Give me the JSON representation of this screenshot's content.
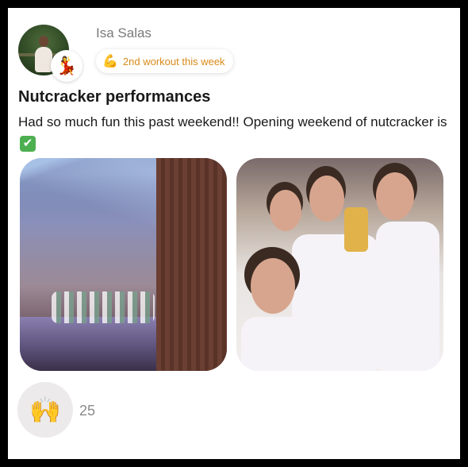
{
  "post": {
    "username": "Isa Salas",
    "badge_emoji": "💃",
    "workout_emoji": "💪",
    "workout_text": "2nd workout this week",
    "title": "Nutcracker performances",
    "body": "Had so much fun this past weekend!! Opening weekend of nutcracker is",
    "body_check": "✔",
    "photos": [
      {
        "name": "stage-photo",
        "alt": "stage performance"
      },
      {
        "name": "dancers-selfie-photo",
        "alt": "dancers selfie"
      }
    ],
    "reaction": {
      "emoji": "🙌",
      "count": "25"
    }
  },
  "colors": {
    "accent": "#d88a1a",
    "username": "#7a7a7a",
    "check": "#4caf50"
  }
}
